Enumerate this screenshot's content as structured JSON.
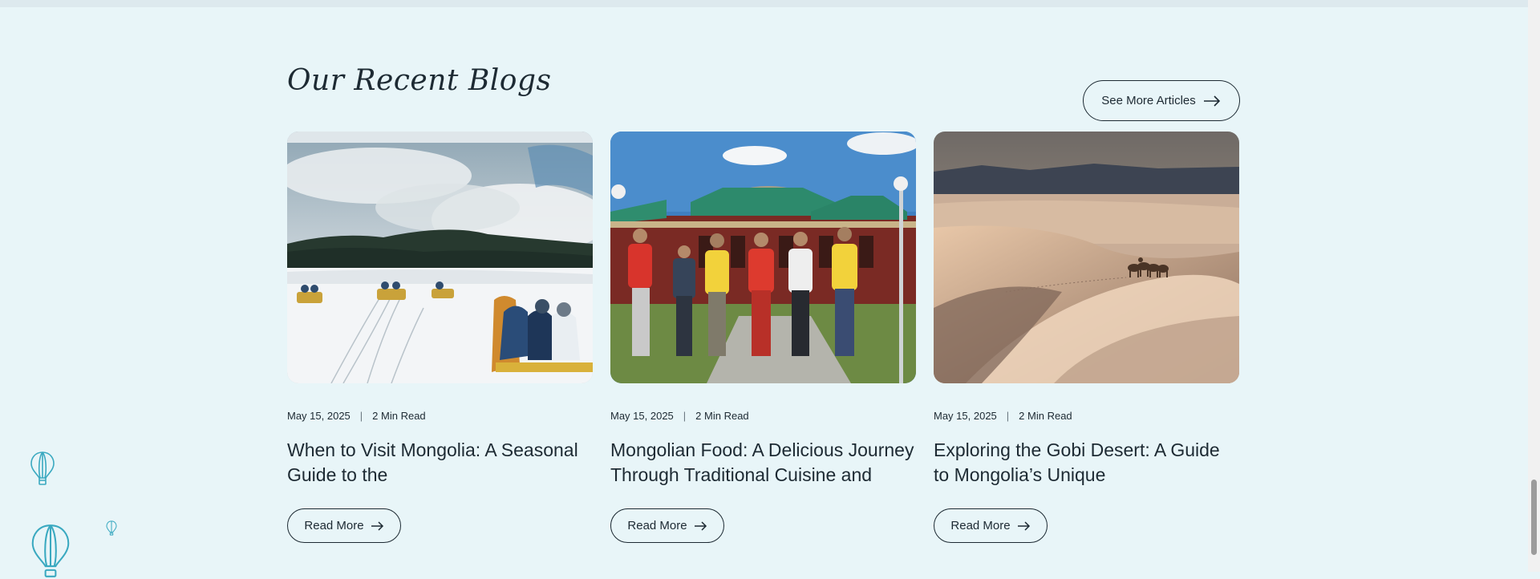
{
  "section": {
    "title": "Our Recent Blogs",
    "see_more_label": "See More Articles",
    "read_more_label": "Read More"
  },
  "posts": [
    {
      "date": "May 15, 2025",
      "read_time": "2 Min Read",
      "title": "When to Visit Mongolia: A Seasonal Guide to the",
      "image": "winter-snow-sledding-scene"
    },
    {
      "date": "May 15, 2025",
      "read_time": "2 Min Read",
      "title": "Mongolian Food: A Delicious Journey Through Traditional Cuisine and",
      "image": "group-in-front-of-temple"
    },
    {
      "date": "May 15, 2025",
      "read_time": "2 Min Read",
      "title": "Exploring the Gobi Desert: A Guide to Mongolia’s Unique",
      "image": "gobi-dunes-with-camels"
    }
  ],
  "decor": {
    "icon": "hot-air-balloon-icon",
    "color": "#3aa9c0"
  },
  "colors": {
    "background": "#e8f5f8",
    "text": "#1d2a33"
  }
}
